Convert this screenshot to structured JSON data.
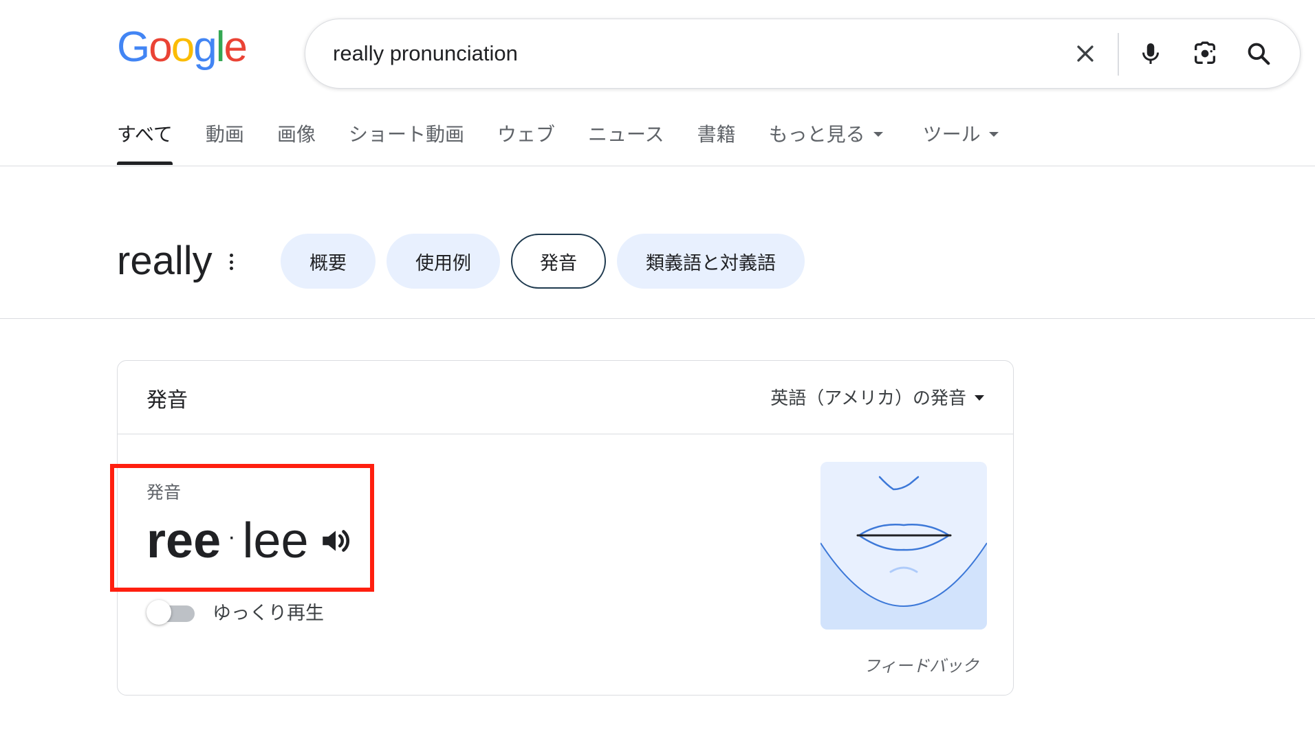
{
  "logo": {
    "letters": [
      "G",
      "o",
      "o",
      "g",
      "l",
      "e"
    ]
  },
  "search": {
    "query": "really pronunciation",
    "icons": [
      "close-icon",
      "mic-icon",
      "lens-icon",
      "search-icon"
    ]
  },
  "tabs": [
    {
      "label": "すべて",
      "active": true
    },
    {
      "label": "動画"
    },
    {
      "label": "画像"
    },
    {
      "label": "ショート動画"
    },
    {
      "label": "ウェブ"
    },
    {
      "label": "ニュース"
    },
    {
      "label": "書籍"
    },
    {
      "label": "もっと見る"
    },
    {
      "label": "ツール"
    }
  ],
  "word": {
    "text": "really"
  },
  "chips": [
    {
      "label": "概要"
    },
    {
      "label": "使用例"
    },
    {
      "label": "発音",
      "active": true
    },
    {
      "label": "類義語と対義語"
    }
  ],
  "card": {
    "title": "発音",
    "language": "英語（アメリカ）の発音",
    "pronunciation_label": "発音",
    "syllables": {
      "stressed": "ree",
      "separator": "·",
      "unstressed": "lee"
    },
    "slow_playback_label": "ゆっくり再生",
    "slow_playback_on": false,
    "feedback": "フィードバック"
  },
  "colors": {
    "google_blue": "#4285F4",
    "google_red": "#EA4335",
    "google_yellow": "#FBBC05",
    "google_green": "#34A853",
    "chip_bg": "#e8f0fe",
    "highlight": "#ff1f0f",
    "mouth_line": "#3c78d8"
  }
}
